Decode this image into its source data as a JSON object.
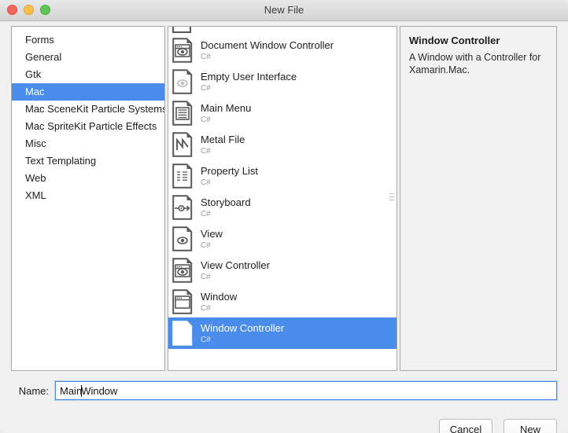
{
  "window": {
    "title": "New File",
    "traffic_lights": [
      "close-button",
      "minimize-button",
      "zoom-button"
    ],
    "accent_color": "#4a8ceb"
  },
  "categories": {
    "items": [
      {
        "label": "Forms",
        "selected": false
      },
      {
        "label": "General",
        "selected": false
      },
      {
        "label": "Gtk",
        "selected": false
      },
      {
        "label": "Mac",
        "selected": true
      },
      {
        "label": "Mac SceneKit Particle Systems",
        "selected": false
      },
      {
        "label": "Mac SpriteKit Particle Effects",
        "selected": false
      },
      {
        "label": "Misc",
        "selected": false
      },
      {
        "label": "Text Templating",
        "selected": false
      },
      {
        "label": "Web",
        "selected": false
      },
      {
        "label": "XML",
        "selected": false
      }
    ]
  },
  "templates": {
    "items": [
      {
        "name": "Document Window Controller",
        "language": "C#",
        "icon": "window-eye-doc-icon",
        "selected": false
      },
      {
        "name": "Empty User Interface",
        "language": "C#",
        "icon": "eye-faded-doc-icon",
        "selected": false
      },
      {
        "name": "Main Menu",
        "language": "C#",
        "icon": "menu-lines-doc-icon",
        "selected": false
      },
      {
        "name": "Metal File",
        "language": "C#",
        "icon": "metal-m-doc-icon",
        "selected": false
      },
      {
        "name": "Property List",
        "language": "C#",
        "icon": "plist-doc-icon",
        "selected": false
      },
      {
        "name": "Storyboard",
        "language": "C#",
        "icon": "storyboard-arrow-doc-icon",
        "selected": false
      },
      {
        "name": "View",
        "language": "C#",
        "icon": "eye-doc-icon",
        "selected": false
      },
      {
        "name": "View Controller",
        "language": "C#",
        "icon": "window-eye-doc-icon",
        "selected": false
      },
      {
        "name": "Window",
        "language": "C#",
        "icon": "window-doc-icon",
        "selected": false
      },
      {
        "name": "Window Controller",
        "language": "C#",
        "icon": "window-eye-doc-icon",
        "selected": true
      }
    ]
  },
  "description": {
    "title": "Window Controller",
    "text": "A Window with a Controller for Xamarin.Mac."
  },
  "name_field": {
    "label": "Name:",
    "value_before_caret": "Main",
    "value_after_caret": "Window",
    "value": "MainWindow",
    "placeholder": ""
  },
  "buttons": {
    "cancel": "Cancel",
    "create": "New"
  }
}
